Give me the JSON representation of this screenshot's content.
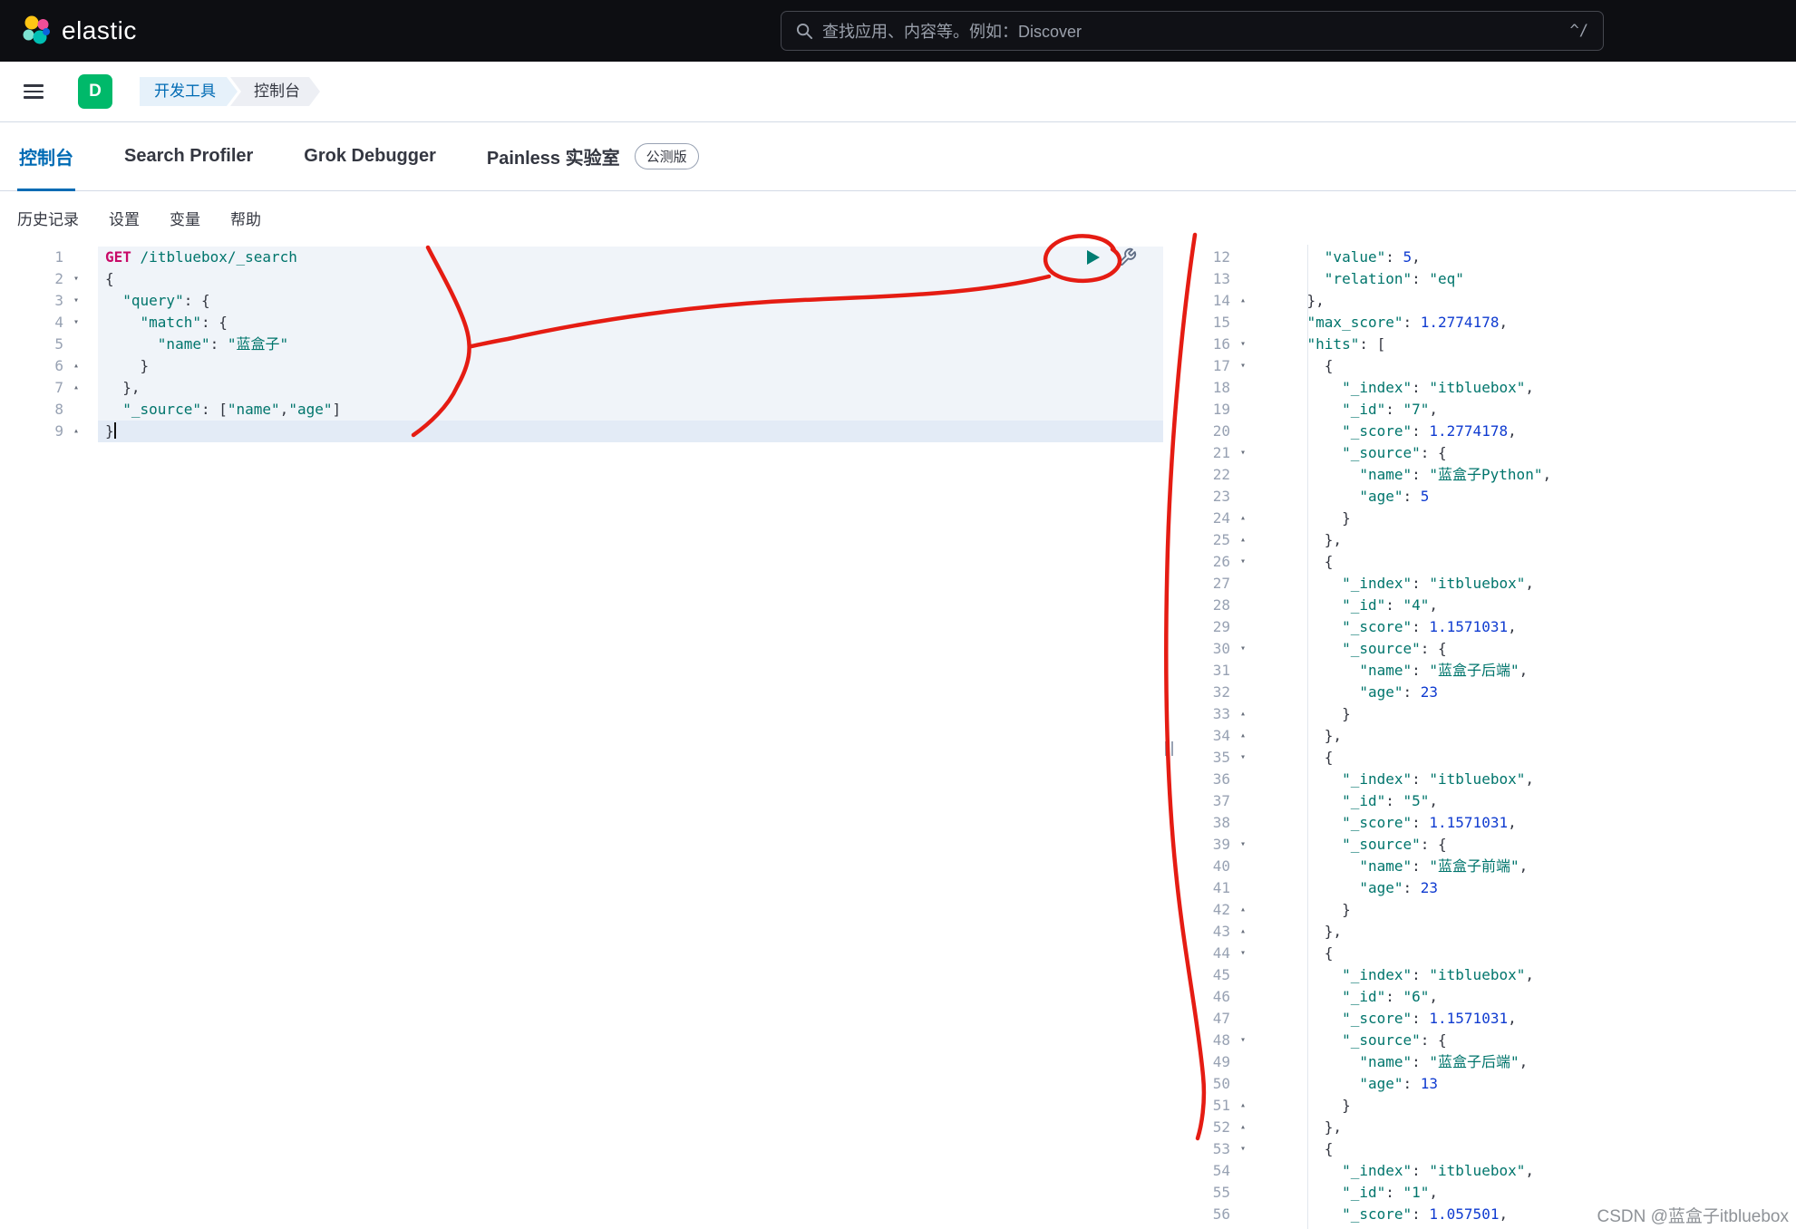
{
  "header": {
    "logo_text": "elastic",
    "search_placeholder": "查找应用、内容等。例如：Discover",
    "shortcut_hint": "^/"
  },
  "nav": {
    "space_initial": "D",
    "breadcrumbs": [
      "开发工具",
      "控制台"
    ]
  },
  "tabs": {
    "items": [
      {
        "label": "控制台",
        "active": true
      },
      {
        "label": "Search Profiler",
        "active": false
      },
      {
        "label": "Grok Debugger",
        "active": false
      },
      {
        "label": "Painless 实验室",
        "active": false,
        "badge": "公测版"
      }
    ]
  },
  "toolbar": {
    "items": [
      "历史记录",
      "设置",
      "变量",
      "帮助"
    ]
  },
  "icons": {
    "fold_down": "▾",
    "fold_up": "▴",
    "search": "magnifier",
    "menu": "hamburger",
    "play": "send-request",
    "wrench": "request-options",
    "grip": "splitter-grip"
  },
  "colors": {
    "accent": "#006bb4",
    "method": "#c80a68",
    "string": "#00756c",
    "number": "#0f3bd0",
    "punct": "#343741",
    "annotation_red": "#e51c13",
    "play_green": "#017d73",
    "space_badge_green": "#00b96a"
  },
  "editor": {
    "lines": [
      {
        "n": 1,
        "hl": true,
        "t": [
          [
            "m",
            "GET"
          ],
          [
            "p",
            " "
          ],
          [
            "u",
            "/itbluebox/_search"
          ]
        ]
      },
      {
        "n": 2,
        "f": "d",
        "hl": true,
        "t": [
          [
            "p",
            "{"
          ]
        ]
      },
      {
        "n": 3,
        "f": "d",
        "hl": true,
        "t": [
          [
            "p",
            "  "
          ],
          [
            "k",
            "\"query\""
          ],
          [
            "p",
            ": {"
          ]
        ]
      },
      {
        "n": 4,
        "f": "d",
        "hl": true,
        "t": [
          [
            "p",
            "    "
          ],
          [
            "k",
            "\"match\""
          ],
          [
            "p",
            ": {"
          ]
        ]
      },
      {
        "n": 5,
        "hl": true,
        "t": [
          [
            "p",
            "      "
          ],
          [
            "k",
            "\"name\""
          ],
          [
            "p",
            ": "
          ],
          [
            "s",
            "\"蓝盒子\""
          ]
        ]
      },
      {
        "n": 6,
        "f": "u",
        "hl": true,
        "t": [
          [
            "p",
            "    }"
          ]
        ]
      },
      {
        "n": 7,
        "f": "u",
        "hl": true,
        "t": [
          [
            "p",
            "  },"
          ]
        ]
      },
      {
        "n": 8,
        "hl": true,
        "t": [
          [
            "p",
            "  "
          ],
          [
            "k",
            "\"_source\""
          ],
          [
            "p",
            ": ["
          ],
          [
            "s",
            "\"name\""
          ],
          [
            "p",
            ","
          ],
          [
            "s",
            "\"age\""
          ],
          [
            "p",
            "]"
          ]
        ]
      },
      {
        "n": 9,
        "f": "u",
        "cur": true,
        "t": [
          [
            "p",
            "}"
          ]
        ]
      }
    ]
  },
  "output": {
    "lines": [
      {
        "n": 12,
        "t": [
          [
            "p",
            "      "
          ],
          [
            "k",
            "\"value\""
          ],
          [
            "p",
            ": "
          ],
          [
            "n",
            "5"
          ],
          [
            "p",
            ","
          ]
        ]
      },
      {
        "n": 13,
        "t": [
          [
            "p",
            "      "
          ],
          [
            "k",
            "\"relation\""
          ],
          [
            "p",
            ": "
          ],
          [
            "s",
            "\"eq\""
          ]
        ]
      },
      {
        "n": 14,
        "f": "u",
        "t": [
          [
            "p",
            "    },"
          ]
        ]
      },
      {
        "n": 15,
        "t": [
          [
            "p",
            "    "
          ],
          [
            "k",
            "\"max_score\""
          ],
          [
            "p",
            ": "
          ],
          [
            "n",
            "1.2774178"
          ],
          [
            "p",
            ","
          ]
        ]
      },
      {
        "n": 16,
        "f": "d",
        "t": [
          [
            "p",
            "    "
          ],
          [
            "k",
            "\"hits\""
          ],
          [
            "p",
            ": ["
          ]
        ]
      },
      {
        "n": 17,
        "f": "d",
        "t": [
          [
            "p",
            "      {"
          ]
        ]
      },
      {
        "n": 18,
        "t": [
          [
            "p",
            "        "
          ],
          [
            "k",
            "\"_index\""
          ],
          [
            "p",
            ": "
          ],
          [
            "s",
            "\"itbluebox\""
          ],
          [
            "p",
            ","
          ]
        ]
      },
      {
        "n": 19,
        "t": [
          [
            "p",
            "        "
          ],
          [
            "k",
            "\"_id\""
          ],
          [
            "p",
            ": "
          ],
          [
            "s",
            "\"7\""
          ],
          [
            "p",
            ","
          ]
        ]
      },
      {
        "n": 20,
        "t": [
          [
            "p",
            "        "
          ],
          [
            "k",
            "\"_score\""
          ],
          [
            "p",
            ": "
          ],
          [
            "n",
            "1.2774178"
          ],
          [
            "p",
            ","
          ]
        ]
      },
      {
        "n": 21,
        "f": "d",
        "t": [
          [
            "p",
            "        "
          ],
          [
            "k",
            "\"_source\""
          ],
          [
            "p",
            ": {"
          ]
        ]
      },
      {
        "n": 22,
        "t": [
          [
            "p",
            "          "
          ],
          [
            "k",
            "\"name\""
          ],
          [
            "p",
            ": "
          ],
          [
            "s",
            "\"蓝盒子Python\""
          ],
          [
            "p",
            ","
          ]
        ]
      },
      {
        "n": 23,
        "t": [
          [
            "p",
            "          "
          ],
          [
            "k",
            "\"age\""
          ],
          [
            "p",
            ": "
          ],
          [
            "n",
            "5"
          ]
        ]
      },
      {
        "n": 24,
        "f": "u",
        "t": [
          [
            "p",
            "        }"
          ]
        ]
      },
      {
        "n": 25,
        "f": "u",
        "t": [
          [
            "p",
            "      },"
          ]
        ]
      },
      {
        "n": 26,
        "f": "d",
        "t": [
          [
            "p",
            "      {"
          ]
        ]
      },
      {
        "n": 27,
        "t": [
          [
            "p",
            "        "
          ],
          [
            "k",
            "\"_index\""
          ],
          [
            "p",
            ": "
          ],
          [
            "s",
            "\"itbluebox\""
          ],
          [
            "p",
            ","
          ]
        ]
      },
      {
        "n": 28,
        "t": [
          [
            "p",
            "        "
          ],
          [
            "k",
            "\"_id\""
          ],
          [
            "p",
            ": "
          ],
          [
            "s",
            "\"4\""
          ],
          [
            "p",
            ","
          ]
        ]
      },
      {
        "n": 29,
        "t": [
          [
            "p",
            "        "
          ],
          [
            "k",
            "\"_score\""
          ],
          [
            "p",
            ": "
          ],
          [
            "n",
            "1.1571031"
          ],
          [
            "p",
            ","
          ]
        ]
      },
      {
        "n": 30,
        "f": "d",
        "t": [
          [
            "p",
            "        "
          ],
          [
            "k",
            "\"_source\""
          ],
          [
            "p",
            ": {"
          ]
        ]
      },
      {
        "n": 31,
        "t": [
          [
            "p",
            "          "
          ],
          [
            "k",
            "\"name\""
          ],
          [
            "p",
            ": "
          ],
          [
            "s",
            "\"蓝盒子后端\""
          ],
          [
            "p",
            ","
          ]
        ]
      },
      {
        "n": 32,
        "t": [
          [
            "p",
            "          "
          ],
          [
            "k",
            "\"age\""
          ],
          [
            "p",
            ": "
          ],
          [
            "n",
            "23"
          ]
        ]
      },
      {
        "n": 33,
        "f": "u",
        "t": [
          [
            "p",
            "        }"
          ]
        ]
      },
      {
        "n": 34,
        "f": "u",
        "t": [
          [
            "p",
            "      },"
          ]
        ]
      },
      {
        "n": 35,
        "f": "d",
        "t": [
          [
            "p",
            "      {"
          ]
        ]
      },
      {
        "n": 36,
        "t": [
          [
            "p",
            "        "
          ],
          [
            "k",
            "\"_index\""
          ],
          [
            "p",
            ": "
          ],
          [
            "s",
            "\"itbluebox\""
          ],
          [
            "p",
            ","
          ]
        ]
      },
      {
        "n": 37,
        "t": [
          [
            "p",
            "        "
          ],
          [
            "k",
            "\"_id\""
          ],
          [
            "p",
            ": "
          ],
          [
            "s",
            "\"5\""
          ],
          [
            "p",
            ","
          ]
        ]
      },
      {
        "n": 38,
        "t": [
          [
            "p",
            "        "
          ],
          [
            "k",
            "\"_score\""
          ],
          [
            "p",
            ": "
          ],
          [
            "n",
            "1.1571031"
          ],
          [
            "p",
            ","
          ]
        ]
      },
      {
        "n": 39,
        "f": "d",
        "t": [
          [
            "p",
            "        "
          ],
          [
            "k",
            "\"_source\""
          ],
          [
            "p",
            ": {"
          ]
        ]
      },
      {
        "n": 40,
        "t": [
          [
            "p",
            "          "
          ],
          [
            "k",
            "\"name\""
          ],
          [
            "p",
            ": "
          ],
          [
            "s",
            "\"蓝盒子前端\""
          ],
          [
            "p",
            ","
          ]
        ]
      },
      {
        "n": 41,
        "t": [
          [
            "p",
            "          "
          ],
          [
            "k",
            "\"age\""
          ],
          [
            "p",
            ": "
          ],
          [
            "n",
            "23"
          ]
        ]
      },
      {
        "n": 42,
        "f": "u",
        "t": [
          [
            "p",
            "        }"
          ]
        ]
      },
      {
        "n": 43,
        "f": "u",
        "t": [
          [
            "p",
            "      },"
          ]
        ]
      },
      {
        "n": 44,
        "f": "d",
        "t": [
          [
            "p",
            "      {"
          ]
        ]
      },
      {
        "n": 45,
        "t": [
          [
            "p",
            "        "
          ],
          [
            "k",
            "\"_index\""
          ],
          [
            "p",
            ": "
          ],
          [
            "s",
            "\"itbluebox\""
          ],
          [
            "p",
            ","
          ]
        ]
      },
      {
        "n": 46,
        "t": [
          [
            "p",
            "        "
          ],
          [
            "k",
            "\"_id\""
          ],
          [
            "p",
            ": "
          ],
          [
            "s",
            "\"6\""
          ],
          [
            "p",
            ","
          ]
        ]
      },
      {
        "n": 47,
        "t": [
          [
            "p",
            "        "
          ],
          [
            "k",
            "\"_score\""
          ],
          [
            "p",
            ": "
          ],
          [
            "n",
            "1.1571031"
          ],
          [
            "p",
            ","
          ]
        ]
      },
      {
        "n": 48,
        "f": "d",
        "t": [
          [
            "p",
            "        "
          ],
          [
            "k",
            "\"_source\""
          ],
          [
            "p",
            ": {"
          ]
        ]
      },
      {
        "n": 49,
        "t": [
          [
            "p",
            "          "
          ],
          [
            "k",
            "\"name\""
          ],
          [
            "p",
            ": "
          ],
          [
            "s",
            "\"蓝盒子后端\""
          ],
          [
            "p",
            ","
          ]
        ]
      },
      {
        "n": 50,
        "t": [
          [
            "p",
            "          "
          ],
          [
            "k",
            "\"age\""
          ],
          [
            "p",
            ": "
          ],
          [
            "n",
            "13"
          ]
        ]
      },
      {
        "n": 51,
        "f": "u",
        "t": [
          [
            "p",
            "        }"
          ]
        ]
      },
      {
        "n": 52,
        "f": "u",
        "t": [
          [
            "p",
            "      },"
          ]
        ]
      },
      {
        "n": 53,
        "f": "d",
        "t": [
          [
            "p",
            "      {"
          ]
        ]
      },
      {
        "n": 54,
        "t": [
          [
            "p",
            "        "
          ],
          [
            "k",
            "\"_index\""
          ],
          [
            "p",
            ": "
          ],
          [
            "s",
            "\"itbluebox\""
          ],
          [
            "p",
            ","
          ]
        ]
      },
      {
        "n": 55,
        "t": [
          [
            "p",
            "        "
          ],
          [
            "k",
            "\"_id\""
          ],
          [
            "p",
            ": "
          ],
          [
            "s",
            "\"1\""
          ],
          [
            "p",
            ","
          ]
        ]
      },
      {
        "n": 56,
        "t": [
          [
            "p",
            "        "
          ],
          [
            "k",
            "\"_score\""
          ],
          [
            "p",
            ": "
          ],
          [
            "n",
            "1.057501"
          ],
          [
            "p",
            ","
          ]
        ]
      }
    ]
  },
  "watermark": "CSDN @蓝盒子itbluebox"
}
